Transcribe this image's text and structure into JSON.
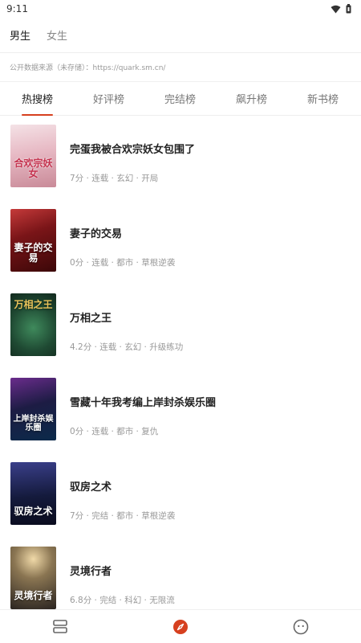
{
  "status_bar": {
    "time": "9:11"
  },
  "gender_tabs": [
    {
      "label": "男生",
      "active": true
    },
    {
      "label": "女生",
      "active": false
    }
  ],
  "source_text": "公开数据来源（未存储）：https://quark.sm.cn/",
  "rank_tabs": [
    {
      "label": "热搜榜",
      "active": true
    },
    {
      "label": "好评榜",
      "active": false
    },
    {
      "label": "完结榜",
      "active": false
    },
    {
      "label": "飙升榜",
      "active": false
    },
    {
      "label": "新书榜",
      "active": false
    }
  ],
  "books": [
    {
      "title": "完蛋我被合欢宗妖女包围了",
      "meta": "7分 · 连载 · 玄幻 · 开局",
      "cover_text": "合欢宗妖女"
    },
    {
      "title": "妻子的交易",
      "meta": "0分 · 连载 · 都市 · 草根逆袭",
      "cover_text": "妻子的交易"
    },
    {
      "title": "万相之王",
      "meta": "4.2分 · 连载 · 玄幻 · 升级练功",
      "cover_text": "万相之王"
    },
    {
      "title": "雪藏十年我考编上岸封杀娱乐圈",
      "meta": "0分 · 连载 · 都市 · 复仇",
      "cover_text": "上岸封杀娱乐圈"
    },
    {
      "title": "驭房之术",
      "meta": "7分 · 完结 · 都市 · 草根逆袭",
      "cover_text": "驭房之术"
    },
    {
      "title": "灵境行者",
      "meta": "6.8分 · 完结 · 科幻 · 无限流",
      "cover_text": "灵境行者"
    }
  ],
  "colors": {
    "accent": "#d6401f",
    "covers": [
      "#e9c6cf",
      "#5a0f12",
      "#1f4a33",
      "#1d1c44",
      "#141a3c",
      "#4a4340"
    ]
  },
  "bottom_nav": [
    {
      "icon": "bookshelf-icon"
    },
    {
      "icon": "compass-icon",
      "active": true
    },
    {
      "icon": "profile-face-icon"
    }
  ]
}
